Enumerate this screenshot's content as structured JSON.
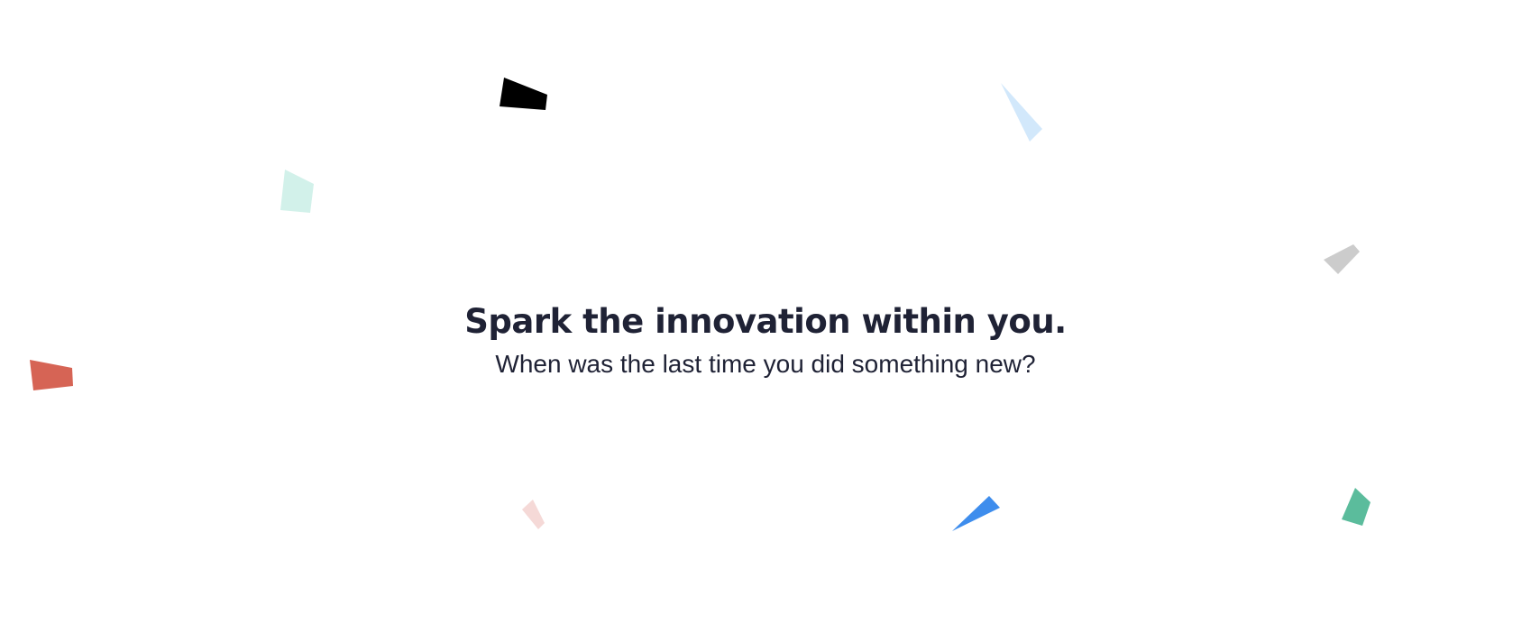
{
  "hero": {
    "title": "Spark the innovation within you.",
    "subtitle": "When was the last time you did something new?"
  },
  "confetti_colors": {
    "black": "#000000",
    "light_blue": "#d2e8fb",
    "mint": "#d2f1ea",
    "gray": "#cccccc",
    "coral": "#d66455",
    "pale_pink": "#f5d9d7",
    "blue": "#3e8ded",
    "green": "#5bbc9c"
  }
}
